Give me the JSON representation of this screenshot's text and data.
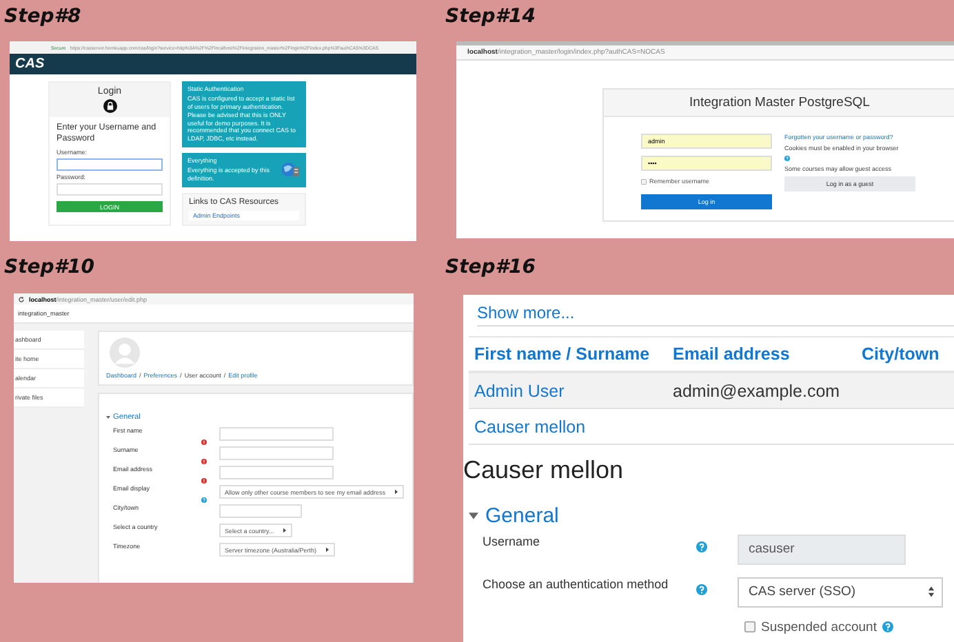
{
  "cas_login": {
    "step_label": "Step#8",
    "address_bar": {
      "secure_label": "Secure",
      "url": "https://casserver.herokuapp.com/cas/login?service=http%3A%2F%2Flocalhost%2Fintegration_master%2Flogin%2Findex.php%3FauthCAS%3DCAS"
    },
    "logo": "CAS",
    "login_card": {
      "title": "Login",
      "heading": "Enter your Username and Password",
      "username_label": "Username:",
      "password_label": "Password:",
      "button": "LOGIN"
    },
    "info_cards": [
      {
        "title": "Static Authentication",
        "body": "CAS is configured to accept a static list of users for primary authentication. Please be advised that this is ONLY useful for demo purposes. It is recommended that you connect CAS to LDAP, JDBC, etc instead."
      },
      {
        "title": "Everything",
        "body": "Everything is accepted by this definition."
      }
    ],
    "links_card": {
      "title": "Links to CAS Resources",
      "link": "Admin Endpoints"
    }
  },
  "moodle_login": {
    "step_label": "Step#14",
    "address_bar": {
      "host": "localhost",
      "path": "/integration_master/login/index.php?authCAS=NOCAS"
    },
    "title": "Integration Master PostgreSQL",
    "username_value": "admin",
    "password_value": "••••",
    "remember": {
      "label": "Remember username",
      "checked": false
    },
    "login_button": "Log in",
    "forgot_link": "Forgotten your username or password?",
    "cookies_note": "Cookies must be enabled in your browser",
    "guest_note": "Some courses may allow guest access",
    "guest_button": "Log in as a guest"
  },
  "edit_profile": {
    "step_label": "Step#10",
    "address_bar": {
      "host": "localhost",
      "path": "/integration_master/user/edit.php"
    },
    "site_name": "integration_master",
    "nav_items": [
      "ashboard",
      "ite home",
      "alendar",
      "rivate files"
    ],
    "breadcrumb_separator": "/",
    "breadcrumb": [
      {
        "text": "Dashboard",
        "link": true
      },
      {
        "text": "Preferences",
        "link": true
      },
      {
        "text": "User account",
        "link": false
      },
      {
        "text": "Edit profile",
        "link": true
      }
    ],
    "section": "General",
    "fields": [
      {
        "label": "First name",
        "kind": "required_text"
      },
      {
        "label": "Surname",
        "kind": "required_text"
      },
      {
        "label": "Email address",
        "kind": "required_text"
      },
      {
        "label": "Email display",
        "kind": "help_select",
        "value": "Allow only other course members to see my email address"
      },
      {
        "label": "City/town",
        "kind": "short"
      },
      {
        "label": "Select a country",
        "kind": "select",
        "value": "Select a country..."
      },
      {
        "label": "Timezone",
        "kind": "select",
        "value": "Server timezone (Australia/Perth)"
      }
    ]
  },
  "user_list": {
    "step_label": "Step#16",
    "show_more": "Show more...",
    "columns": [
      "First name / Surname",
      "Email address",
      "City/town"
    ],
    "rows": [
      {
        "name": "Admin User",
        "email": "admin@example.com"
      },
      {
        "name": "Causer mellon"
      }
    ],
    "heading": "Causer mellon",
    "section": "General",
    "fields": [
      {
        "label": "Username",
        "kind": "readonly",
        "value": "casuser"
      },
      {
        "label": "Choose an authentication method",
        "kind": "select",
        "value": "CAS server (SSO)"
      }
    ],
    "suspended": {
      "label": "Suspended account",
      "checked": false
    }
  }
}
